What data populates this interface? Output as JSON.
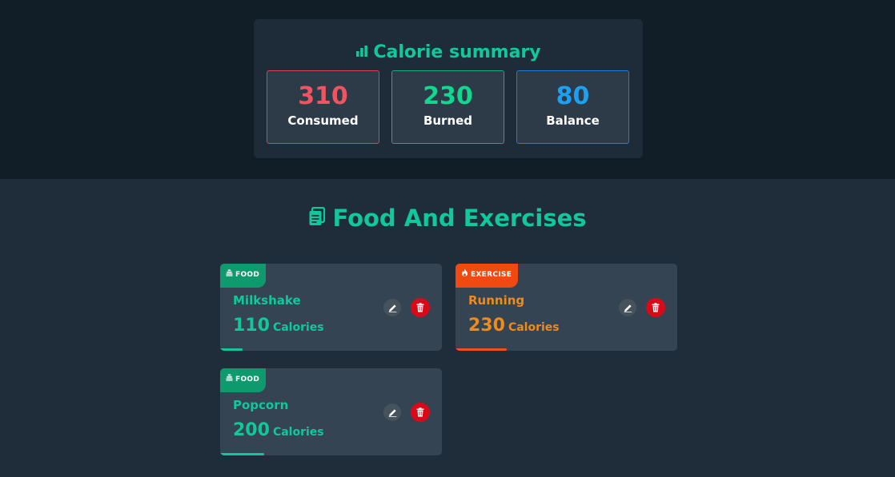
{
  "summary": {
    "title": "Calorie summary",
    "title_icon": "bar-chart-icon",
    "stats": {
      "consumed": {
        "value": "310",
        "label": "Consumed",
        "color": "#f05462"
      },
      "burned": {
        "value": "230",
        "label": "Burned",
        "color": "#10d88e"
      },
      "balance": {
        "value": "80",
        "label": "Balance",
        "color": "#1ea0f0"
      }
    }
  },
  "list": {
    "title": "Food And Exercises",
    "title_icon": "clipboard-icon",
    "unit_label": "Calories",
    "entries": [
      {
        "type_label": "FOOD",
        "type_icon": "food-icon",
        "name": "Milkshake",
        "calories": "110",
        "progress": 0.1,
        "accent": "#10c89a"
      },
      {
        "type_label": "EXERCISE",
        "type_icon": "fire-icon",
        "name": "Running",
        "calories": "230",
        "progress": 0.23,
        "accent": "#f08a1a"
      },
      {
        "type_label": "FOOD",
        "type_icon": "food-icon",
        "name": "Popcorn",
        "calories": "200",
        "progress": 0.2,
        "accent": "#10c89a"
      }
    ],
    "edit_icon": "edit-icon",
    "delete_icon": "trash-icon"
  }
}
